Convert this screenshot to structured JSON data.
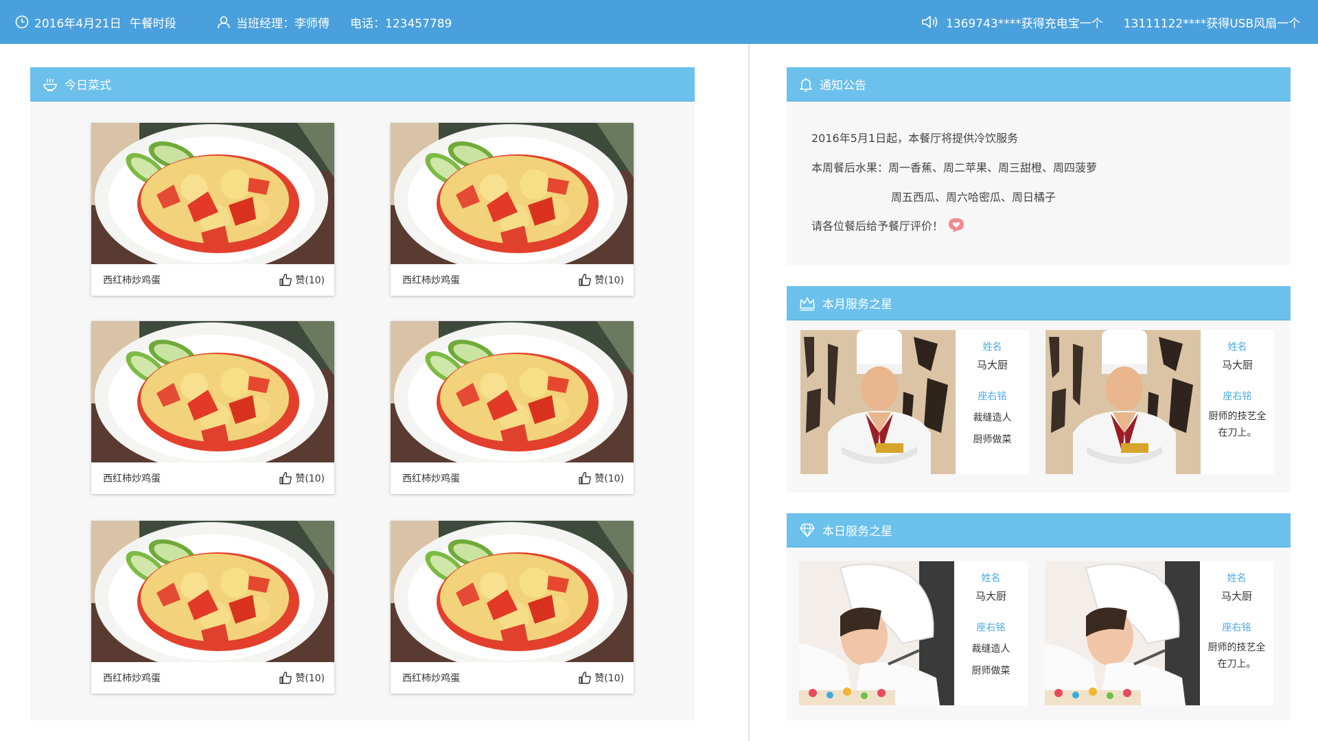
{
  "topbar": {
    "date": "2016年4月21日",
    "meal_period": "午餐时段",
    "manager": "当班经理：李师傅",
    "phone": "电话：123457789",
    "prize1": "1369743****获得充电宝一个",
    "prize2": "13111122****获得USB风扇一个"
  },
  "menu": {
    "title": "今日菜式",
    "dishes": [
      {
        "name": "西红柿炒鸡蛋",
        "likes": "赞(10)"
      },
      {
        "name": "西红柿炒鸡蛋",
        "likes": "赞(10)"
      },
      {
        "name": "西红柿炒鸡蛋",
        "likes": "赞(10)"
      },
      {
        "name": "西红柿炒鸡蛋",
        "likes": "赞(10)"
      },
      {
        "name": "西红柿炒鸡蛋",
        "likes": "赞(10)"
      },
      {
        "name": "西红柿炒鸡蛋",
        "likes": "赞(10)"
      }
    ]
  },
  "notice": {
    "title": "通知公告",
    "lines": [
      "2016年5月1日起，本餐厅将提供冷饮服务",
      "本周餐后水果：周一香蕉、周二苹果、周三甜橙、周四菠萝",
      "周五西瓜、周六哈密瓜、周日橘子",
      "请各位餐后给予餐厅评价！"
    ]
  },
  "month_star": {
    "title": "本月服务之星",
    "cards": [
      {
        "name_label": "姓名",
        "name": "马大厨",
        "motto_label": "座右铭",
        "motto": "裁缝造人\n厨师做菜"
      },
      {
        "name_label": "姓名",
        "name": "马大厨",
        "motto_label": "座右铭",
        "motto": "厨师的技艺全在刀上。"
      }
    ]
  },
  "day_star": {
    "title": "本日服务之星",
    "cards": [
      {
        "name_label": "姓名",
        "name": "马大厨",
        "motto_label": "座右铭",
        "motto": "裁缝造人\n厨师做菜"
      },
      {
        "name_label": "姓名",
        "name": "马大厨",
        "motto_label": "座右铭",
        "motto": "厨师的技艺全在刀上。"
      }
    ]
  },
  "colors": {
    "topbar": "#4aa0dc",
    "panel_header": "#6bc0ec",
    "label_blue": "#4aa9e4",
    "panel_bg": "#f7f7f7"
  },
  "icons": {
    "clock": "clock-icon",
    "user": "user-icon",
    "speaker": "speaker-icon",
    "bowl": "bowl-icon",
    "bell": "bell-icon",
    "crown": "crown-icon",
    "diamond": "diamond-icon",
    "thumb": "thumbs-up-icon",
    "heart": "heart-bubble-icon"
  }
}
